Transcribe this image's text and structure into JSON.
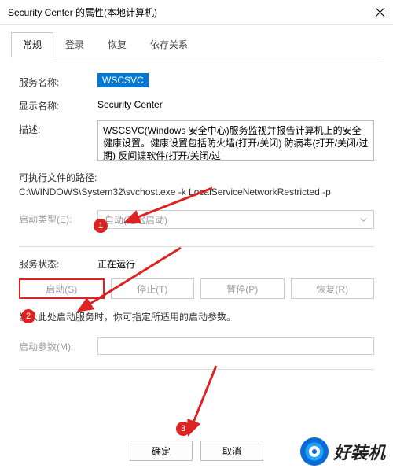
{
  "window": {
    "title": "Security Center 的属性(本地计算机)"
  },
  "tabs": [
    {
      "label": "常规",
      "active": true
    },
    {
      "label": "登录",
      "active": false
    },
    {
      "label": "恢复",
      "active": false
    },
    {
      "label": "依存关系",
      "active": false
    }
  ],
  "fields": {
    "service_name_label": "服务名称:",
    "service_name_value": "WSCSVC",
    "display_name_label": "显示名称:",
    "display_name_value": "Security Center",
    "desc_label": "描述:",
    "desc_value": "WSCSVC(Windows 安全中心)服务监视并报告计算机上的安全健康设置。健康设置包括防火墙(打开/关闭) 防病毒(打开/关闭/过期)   反间谍软件(打开/关闭/过",
    "exe_path_label": "可执行文件的路径:",
    "exe_path_value": "C:\\WINDOWS\\System32\\svchost.exe -k LocalServiceNetworkRestricted -p",
    "startup_type_label": "启动类型(E):",
    "startup_type_value": "自动(延迟启动)",
    "status_label": "服务状态:",
    "status_value": "正在运行",
    "note": "当从此处启动服务时，你可指定所适用的启动参数。",
    "param_label": "启动参数(M):"
  },
  "service_buttons": {
    "start": "启动(S)",
    "stop": "停止(T)",
    "pause": "暂停(P)",
    "resume": "恢复(R)"
  },
  "dialog_buttons": {
    "ok": "确定",
    "cancel": "取消"
  },
  "annotations": {
    "b1": "1",
    "b2": "2",
    "b3": "3"
  },
  "watermark": {
    "text": "好装机"
  }
}
